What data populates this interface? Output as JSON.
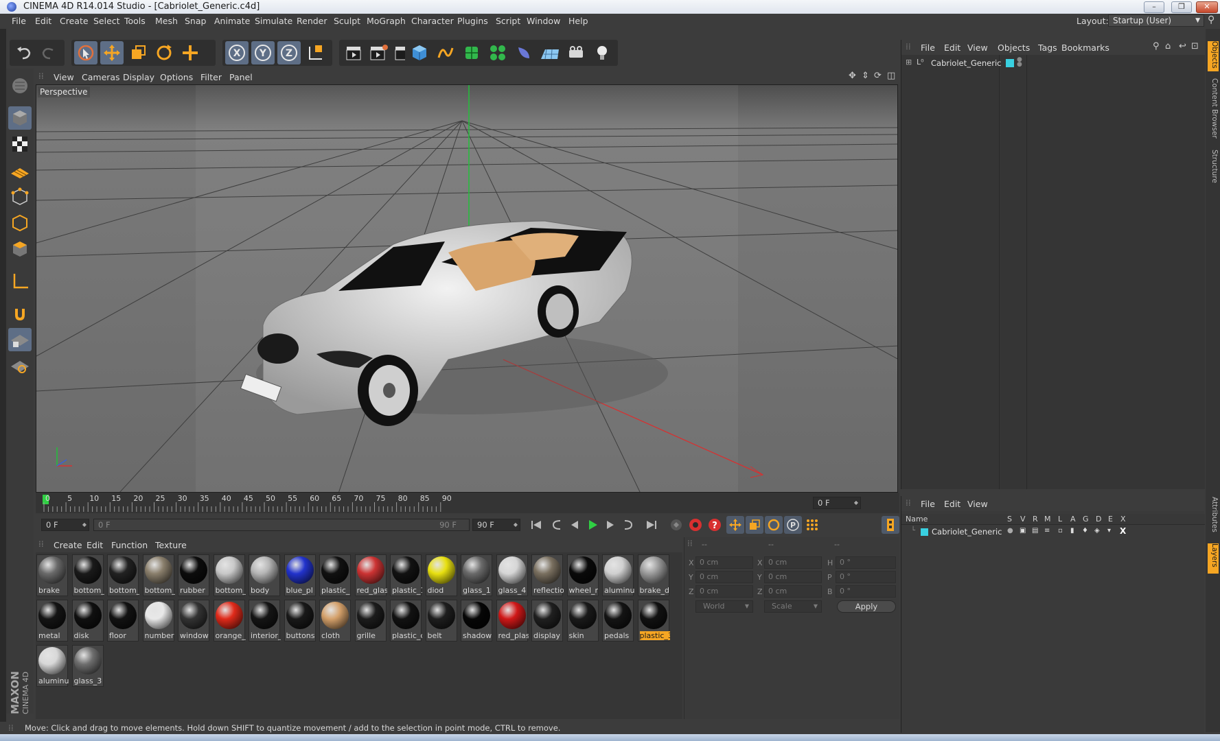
{
  "window": {
    "title": "CINEMA 4D R14.014 Studio - [Cabriolet_Generic.c4d]",
    "minimize": "–",
    "restore": "❐",
    "close": "✕"
  },
  "menubar": {
    "items": [
      "File",
      "Edit",
      "Create",
      "Select",
      "Tools",
      "Mesh",
      "Snap",
      "Animate",
      "Simulate",
      "Render",
      "Sculpt",
      "MoGraph",
      "Character",
      "Plugins",
      "Script",
      "Window",
      "Help"
    ],
    "layout_label": "Layout:",
    "layout_value": "Startup (User)"
  },
  "viewport": {
    "menu": [
      "View",
      "Cameras",
      "Display",
      "Options",
      "Filter",
      "Panel"
    ],
    "label": "Perspective"
  },
  "timeline": {
    "ticks": [
      "0",
      "5",
      "10",
      "15",
      "20",
      "25",
      "30",
      "35",
      "40",
      "45",
      "50",
      "55",
      "60",
      "65",
      "70",
      "75",
      "80",
      "85",
      "90"
    ],
    "end_field": "0 F",
    "current_frame": "0 F",
    "range_start": "0 F",
    "range_end": "90 F",
    "max_frame": "90 F"
  },
  "materials": {
    "menu": [
      "Create",
      "Edit",
      "Function",
      "Texture"
    ],
    "items": [
      {
        "label": "brake",
        "color": "#6a6a6a"
      },
      {
        "label": "bottom_",
        "color": "#1a1a1a"
      },
      {
        "label": "bottom_",
        "color": "#222222"
      },
      {
        "label": "bottom_",
        "color": "#8a7f6c"
      },
      {
        "label": "rubber",
        "color": "#0c0c0c"
      },
      {
        "label": "bottom_",
        "color": "#c8c8c8"
      },
      {
        "label": "body",
        "color": "#b5b5b5"
      },
      {
        "label": "blue_pl",
        "color": "#2233cc"
      },
      {
        "label": "plastic_",
        "color": "#111111"
      },
      {
        "label": "red_glas",
        "color": "#cc3333"
      },
      {
        "label": "plastic_1",
        "color": "#121212"
      },
      {
        "label": "diod",
        "color": "#e8e010"
      },
      {
        "label": "glass_1",
        "color": "#6a6a6a"
      },
      {
        "label": "glass_4",
        "color": "#d6d6d6"
      },
      {
        "label": "reflectio",
        "color": "#7a7060"
      },
      {
        "label": "wheel_r",
        "color": "#0a0a0a"
      },
      {
        "label": "aluminu",
        "color": "#d0d0d0"
      },
      {
        "label": "brake_d",
        "color": "#9a9a9a"
      },
      {
        "label": "metal",
        "color": "#141414"
      },
      {
        "label": "disk",
        "color": "#101010"
      },
      {
        "label": "floor",
        "color": "#121212"
      },
      {
        "label": "number",
        "color": "#e8e8e8"
      },
      {
        "label": "window",
        "color": "#333333"
      },
      {
        "label": "orange_",
        "color": "#e02a1a"
      },
      {
        "label": "interior_",
        "color": "#151515"
      },
      {
        "label": "buttons",
        "color": "#191919"
      },
      {
        "label": "cloth",
        "color": "#d4a06a"
      },
      {
        "label": "grille",
        "color": "#1c1c1c"
      },
      {
        "label": "plastic_c",
        "color": "#121212"
      },
      {
        "label": "belt",
        "color": "#1e1e1e"
      },
      {
        "label": "shadow",
        "color": "#060606"
      },
      {
        "label": "red_plas",
        "color": "#d01818"
      },
      {
        "label": "display",
        "color": "#202020"
      },
      {
        "label": "skin",
        "color": "#1a1a1a"
      },
      {
        "label": "pedals",
        "color": "#141414"
      },
      {
        "label": "plastic_3",
        "color": "#111111"
      },
      {
        "label": "aluminu",
        "color": "#d8d8d8"
      },
      {
        "label": "glass_3",
        "color": "#6e6e6e"
      }
    ],
    "selected_index": 35
  },
  "coordinates": {
    "headers": [
      "--",
      "--",
      "--"
    ],
    "rows": [
      {
        "a1": "X",
        "v1": "0 cm",
        "a2": "X",
        "v2": "0 cm",
        "a3": "H",
        "v3": "0 °"
      },
      {
        "a1": "Y",
        "v1": "0 cm",
        "a2": "Y",
        "v2": "0 cm",
        "a3": "P",
        "v3": "0 °"
      },
      {
        "a1": "Z",
        "v1": "0 cm",
        "a2": "Z",
        "v2": "0 cm",
        "a3": "B",
        "v3": "0 °"
      }
    ],
    "space": "World",
    "mode": "Scale",
    "apply": "Apply"
  },
  "object_manager": {
    "menu": [
      "File",
      "Edit",
      "View",
      "Objects",
      "Tags",
      "Bookmarks"
    ],
    "object": "Cabriolet_Generic",
    "layer_color": "#39d0e0"
  },
  "attribute_manager": {
    "menu": [
      "File",
      "Edit",
      "View"
    ],
    "columns": [
      "Name",
      "S",
      "V",
      "R",
      "M",
      "L",
      "A",
      "G",
      "D",
      "E",
      "X"
    ],
    "layer_name": "Cabriolet_Generic"
  },
  "right_tabs": [
    "Objects",
    "Content Browser",
    "Structure",
    "Attributes",
    "Layers"
  ],
  "status": "Move: Click and drag to move elements. Hold down SHIFT to quantize movement / add to the selection in point mode, CTRL to remove.",
  "brand": {
    "line1": "MAXON",
    "line2": "CINEMA 4D"
  }
}
